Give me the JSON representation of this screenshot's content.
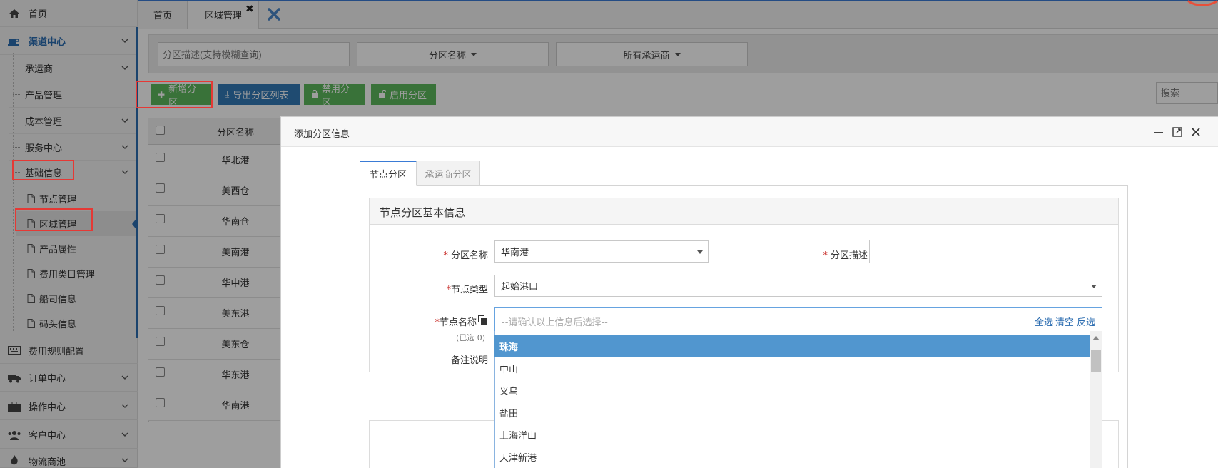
{
  "sidebar": {
    "items": [
      {
        "label": "首页"
      },
      {
        "label": "渠道中心"
      },
      {
        "label": "承运商"
      },
      {
        "label": "产品管理"
      },
      {
        "label": "成本管理"
      },
      {
        "label": "服务中心"
      },
      {
        "label": "基础信息"
      },
      {
        "label": "节点管理"
      },
      {
        "label": "区域管理"
      },
      {
        "label": "产品属性"
      },
      {
        "label": "费用类目管理"
      },
      {
        "label": "船司信息"
      },
      {
        "label": "码头信息"
      },
      {
        "label": "费用规则配置"
      },
      {
        "label": "订单中心"
      },
      {
        "label": "操作中心"
      },
      {
        "label": "客户中心"
      },
      {
        "label": "物流商池"
      }
    ]
  },
  "tabs": [
    {
      "label": "首页"
    },
    {
      "label": "区域管理"
    }
  ],
  "filters": {
    "desc_placeholder": "分区描述(支持模糊查询)",
    "name_select": "分区名称",
    "carrier_select": "所有承运商"
  },
  "toolbar": {
    "add": "新增分区",
    "export": "导出分区列表",
    "disable": "禁用分区",
    "enable": "启用分区",
    "search_placeholder": "搜索"
  },
  "table": {
    "header": "分区名称",
    "rows": [
      "华北港",
      "美西仓",
      "华南仓",
      "美南港",
      "华中港",
      "美东港",
      "美东仓",
      "华东港",
      "华南港"
    ]
  },
  "modal": {
    "title": "添加分区信息",
    "tabs": [
      "节点分区",
      "承运商分区"
    ],
    "panel_title": "节点分区基本信息",
    "fields": {
      "zone_name_label": "分区名称",
      "zone_name_value": "华南港",
      "zone_desc_label": "分区描述",
      "node_type_label": "节点类型",
      "node_type_value": "起始港口",
      "node_name_label": "节点名称",
      "selected_count": "(已选 0)",
      "node_placeholder": "--请确认以上信息后选择--",
      "select_all": "全选",
      "clear": "清空",
      "invert": "反选",
      "remark_label": "备注说明"
    },
    "options": [
      "珠海",
      "中山",
      "义乌",
      "盐田",
      "上海洋山",
      "天津新港"
    ]
  },
  "colors": {
    "accent": "#3a7bd5",
    "highlight": "#5196cf",
    "green": "#5cb85c",
    "blue": "#337ab7",
    "annotation_red": "#e53935"
  }
}
